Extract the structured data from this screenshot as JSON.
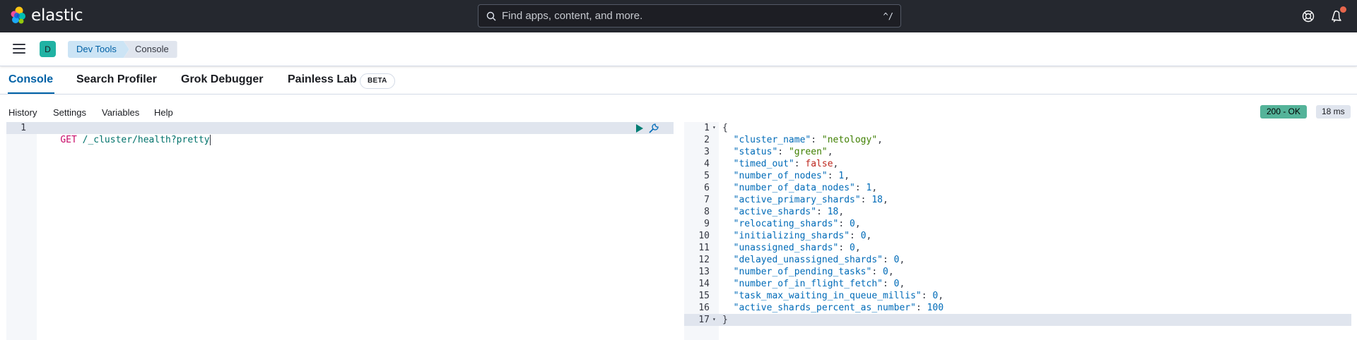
{
  "header": {
    "logo_text": "elastic",
    "search_placeholder": "Find apps, content, and more.",
    "search_shortcut": "^/",
    "icons": [
      "elastic-logo-icon",
      "search-icon",
      "help-icon",
      "notifications-icon"
    ]
  },
  "subbar": {
    "space_initial": "D",
    "breadcrumbs": [
      "Dev Tools",
      "Console"
    ]
  },
  "tabs": [
    {
      "label": "Console",
      "active": true
    },
    {
      "label": "Search Profiler",
      "active": false
    },
    {
      "label": "Grok Debugger",
      "active": false
    },
    {
      "label": "Painless Lab",
      "active": false
    }
  ],
  "beta_badge": "BETA",
  "console_menu": [
    "History",
    "Settings",
    "Variables",
    "Help"
  ],
  "status": {
    "code": "200 - OK",
    "time": "18 ms"
  },
  "request": {
    "line_number": "1",
    "method": "GET",
    "path": "/_cluster/health?pretty"
  },
  "response": {
    "line_numbers": [
      "1",
      "2",
      "3",
      "4",
      "5",
      "6",
      "7",
      "8",
      "9",
      "10",
      "11",
      "12",
      "13",
      "14",
      "15",
      "16",
      "17"
    ],
    "open_brace": "{",
    "close_brace": "}",
    "fields": [
      {
        "key": "\"cluster_name\"",
        "value": "\"netology\"",
        "type": "str",
        "comma": ","
      },
      {
        "key": "\"status\"",
        "value": "\"green\"",
        "type": "str",
        "comma": ","
      },
      {
        "key": "\"timed_out\"",
        "value": "false",
        "type": "bool",
        "comma": ","
      },
      {
        "key": "\"number_of_nodes\"",
        "value": "1",
        "type": "num",
        "comma": ","
      },
      {
        "key": "\"number_of_data_nodes\"",
        "value": "1",
        "type": "num",
        "comma": ","
      },
      {
        "key": "\"active_primary_shards\"",
        "value": "18",
        "type": "num",
        "comma": ","
      },
      {
        "key": "\"active_shards\"",
        "value": "18",
        "type": "num",
        "comma": ","
      },
      {
        "key": "\"relocating_shards\"",
        "value": "0",
        "type": "num",
        "comma": ","
      },
      {
        "key": "\"initializing_shards\"",
        "value": "0",
        "type": "num",
        "comma": ","
      },
      {
        "key": "\"unassigned_shards\"",
        "value": "0",
        "type": "num",
        "comma": ","
      },
      {
        "key": "\"delayed_unassigned_shards\"",
        "value": "0",
        "type": "num",
        "comma": ","
      },
      {
        "key": "\"number_of_pending_tasks\"",
        "value": "0",
        "type": "num",
        "comma": ","
      },
      {
        "key": "\"number_of_in_flight_fetch\"",
        "value": "0",
        "type": "num",
        "comma": ","
      },
      {
        "key": "\"task_max_waiting_in_queue_millis\"",
        "value": "0",
        "type": "num",
        "comma": ","
      },
      {
        "key": "\"active_shards_percent_as_number\"",
        "value": "100",
        "type": "num",
        "comma": ""
      }
    ]
  },
  "colors": {
    "header_bg": "#25282f",
    "accent": "#0061a6",
    "status_ok": "#54b399",
    "space_avatar": "#20b2a3"
  }
}
